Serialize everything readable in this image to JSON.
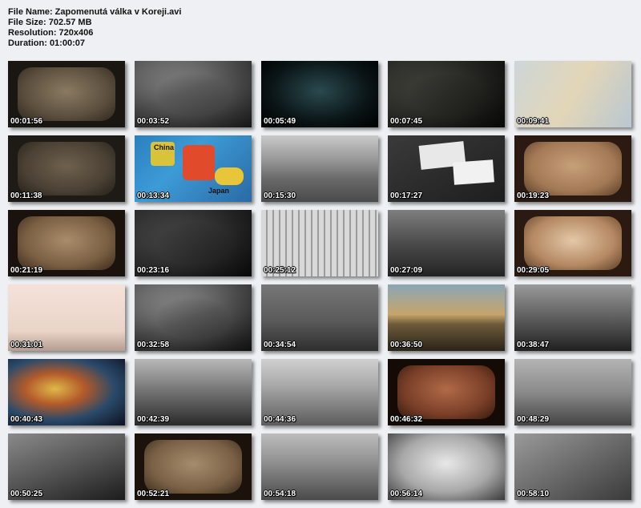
{
  "info": {
    "file_name": "File Name: Zapomenutá válka v Koreji.avi",
    "file_size": "File Size: 702.57 MB",
    "resolution": "Resolution: 720x406",
    "duration": "Duration: 01:00:07"
  },
  "thumbnails": [
    {
      "time": "00:01:56"
    },
    {
      "time": "00:03:52"
    },
    {
      "time": "00:05:49"
    },
    {
      "time": "00:07:45"
    },
    {
      "time": "00:09:41"
    },
    {
      "time": "00:11:38"
    },
    {
      "time": "00:13:34"
    },
    {
      "time": "00:15:30"
    },
    {
      "time": "00:17:27"
    },
    {
      "time": "00:19:23"
    },
    {
      "time": "00:21:19"
    },
    {
      "time": "00:23:16"
    },
    {
      "time": "00:25:12"
    },
    {
      "time": "00:27:09"
    },
    {
      "time": "00:29:05"
    },
    {
      "time": "00:31:01"
    },
    {
      "time": "00:32:58"
    },
    {
      "time": "00:34:54"
    },
    {
      "time": "00:36:50"
    },
    {
      "time": "00:38:47"
    },
    {
      "time": "00:40:43"
    },
    {
      "time": "00:42:39"
    },
    {
      "time": "00:44:36"
    },
    {
      "time": "00:46:32"
    },
    {
      "time": "00:48:29"
    },
    {
      "time": "00:50:25"
    },
    {
      "time": "00:52:21"
    },
    {
      "time": "00:54:18"
    },
    {
      "time": "00:56:14"
    },
    {
      "time": "00:58:10"
    }
  ],
  "map_labels": {
    "china": "China",
    "japan": "Japan"
  }
}
